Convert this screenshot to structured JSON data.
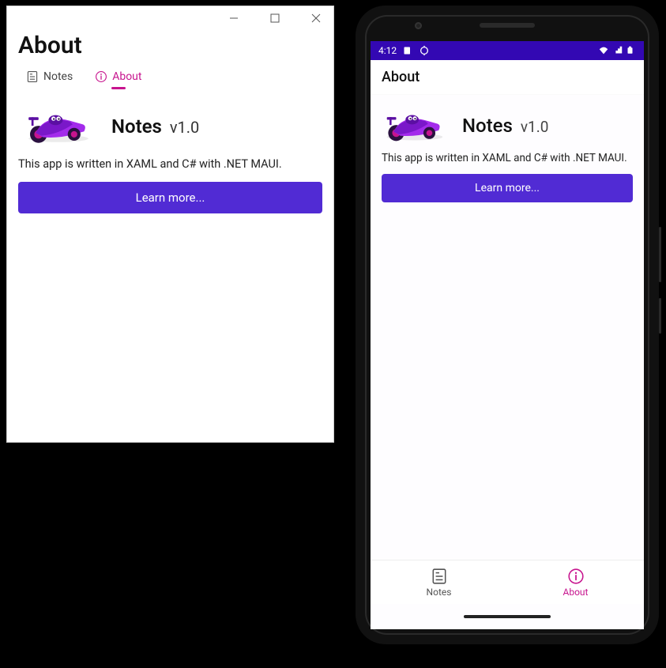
{
  "windows": {
    "heading": "About",
    "tabs": {
      "notes": "Notes",
      "about": "About"
    },
    "app_name": "Notes",
    "app_version": "v1.0",
    "description": "This app is written in XAML and C# with .NET MAUI.",
    "learn_more": "Learn more..."
  },
  "android": {
    "status_time": "4:12",
    "appbar_title": "About",
    "app_name": "Notes",
    "app_version": "v1.0",
    "description": "This app is written in XAML and C# with .NET MAUI.",
    "learn_more": "Learn more...",
    "tabs": {
      "notes": "Notes",
      "about": "About"
    }
  },
  "colors": {
    "accent": "#c7148e",
    "primary_button": "#512bd4",
    "android_status": "#3308b3"
  }
}
